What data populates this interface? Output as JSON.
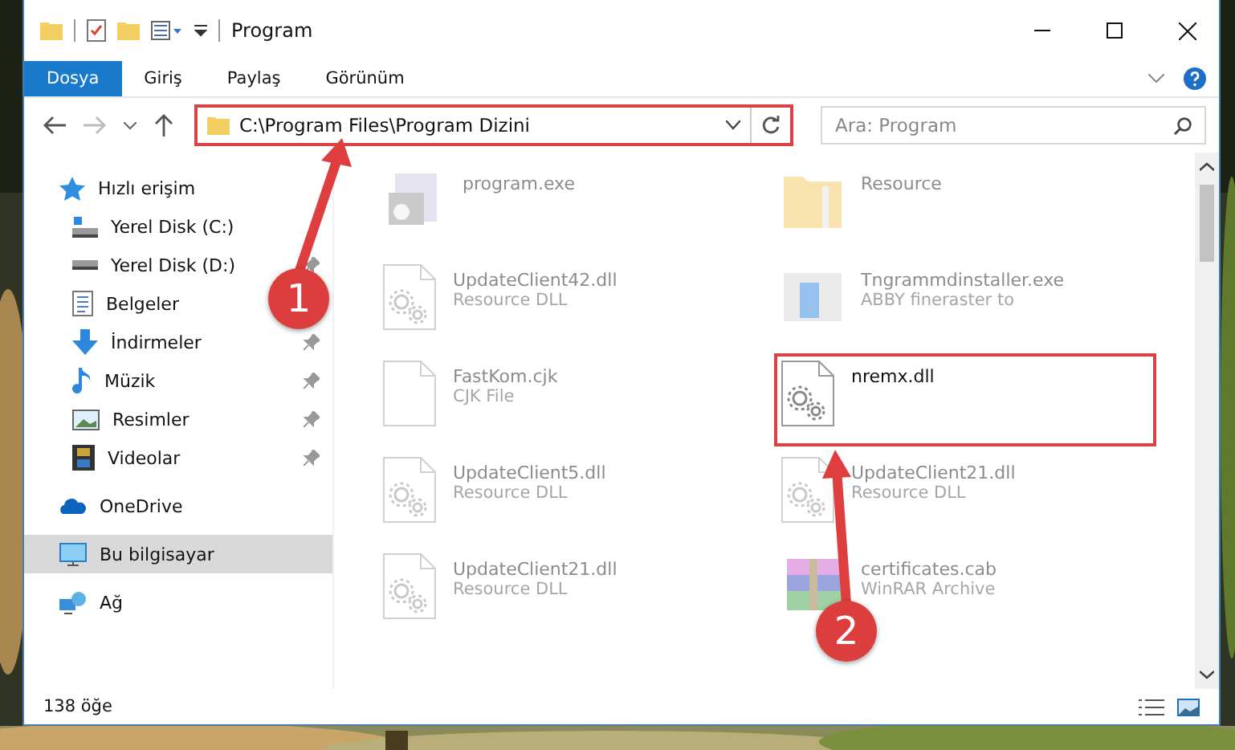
{
  "window": {
    "title": "Program"
  },
  "ribbon_tabs": [
    {
      "label": "Dosya",
      "selected": true
    },
    {
      "label": "Giriş",
      "selected": false
    },
    {
      "label": "Paylaş",
      "selected": false
    },
    {
      "label": "Görünüm",
      "selected": false
    }
  ],
  "address": {
    "value": "C:\\Program Files\\Program Dizini"
  },
  "search": {
    "placeholder": "Ara: Program"
  },
  "sidebar": {
    "items": [
      {
        "label": "Hızlı erişim",
        "kind": "star",
        "children": [
          {
            "label": "Yerel Disk (C:)",
            "kind": "disk",
            "pinned": false
          },
          {
            "label": "Yerel Disk (D:)",
            "kind": "disk",
            "pinned": true
          },
          {
            "label": "Belgeler",
            "kind": "docs",
            "pinned": false
          },
          {
            "label": "İndirmeler",
            "kind": "download",
            "pinned": true
          },
          {
            "label": "Müzik",
            "kind": "music",
            "pinned": true
          },
          {
            "label": "Resimler",
            "kind": "pictures",
            "pinned": true
          },
          {
            "label": "Videolar",
            "kind": "video",
            "pinned": true
          }
        ]
      },
      {
        "label": "OneDrive",
        "kind": "cloud",
        "selected": false
      },
      {
        "label": "Bu bilgisayar",
        "kind": "pc",
        "selected": true
      },
      {
        "label": "Ağ",
        "kind": "network",
        "selected": false
      }
    ]
  },
  "files": [
    {
      "name": "program.exe",
      "kind": "exe",
      "blurred": true,
      "highlighted": false
    },
    {
      "name": "Resource",
      "kind": "folder",
      "blurred": true,
      "highlighted": false
    },
    {
      "name": "UpdateClient42.dll",
      "type": "Resource DLL",
      "kind": "dll",
      "blurred": true,
      "highlighted": false
    },
    {
      "name": "Tngrammdinstaller.exe",
      "type": "ABBY fineraster to",
      "kind": "installer",
      "blurred": true,
      "highlighted": false
    },
    {
      "name": "FastKom.cjk",
      "type": "CJK File",
      "kind": "file",
      "blurred": true,
      "highlighted": false
    },
    {
      "name": "nremx.dll",
      "kind": "dll",
      "blurred": false,
      "highlighted": true
    },
    {
      "name": "UpdateClient5.dll",
      "type": "Resource DLL",
      "kind": "dll",
      "blurred": true,
      "highlighted": false
    },
    {
      "name": "UpdateClient21.dll",
      "type": "Resource DLL",
      "kind": "dll",
      "blurred": true,
      "highlighted": false
    },
    {
      "name": "UpdateClient21.dll",
      "type": "Resource DLL",
      "kind": "dll",
      "blurred": true,
      "highlighted": false
    },
    {
      "name": "certificates.cab",
      "type": "WinRAR Archive",
      "kind": "archive",
      "blurred": true,
      "highlighted": false
    }
  ],
  "status_bar": {
    "count": "138 öğe"
  },
  "annotations": [
    {
      "number": "1"
    },
    {
      "number": "2"
    }
  ]
}
